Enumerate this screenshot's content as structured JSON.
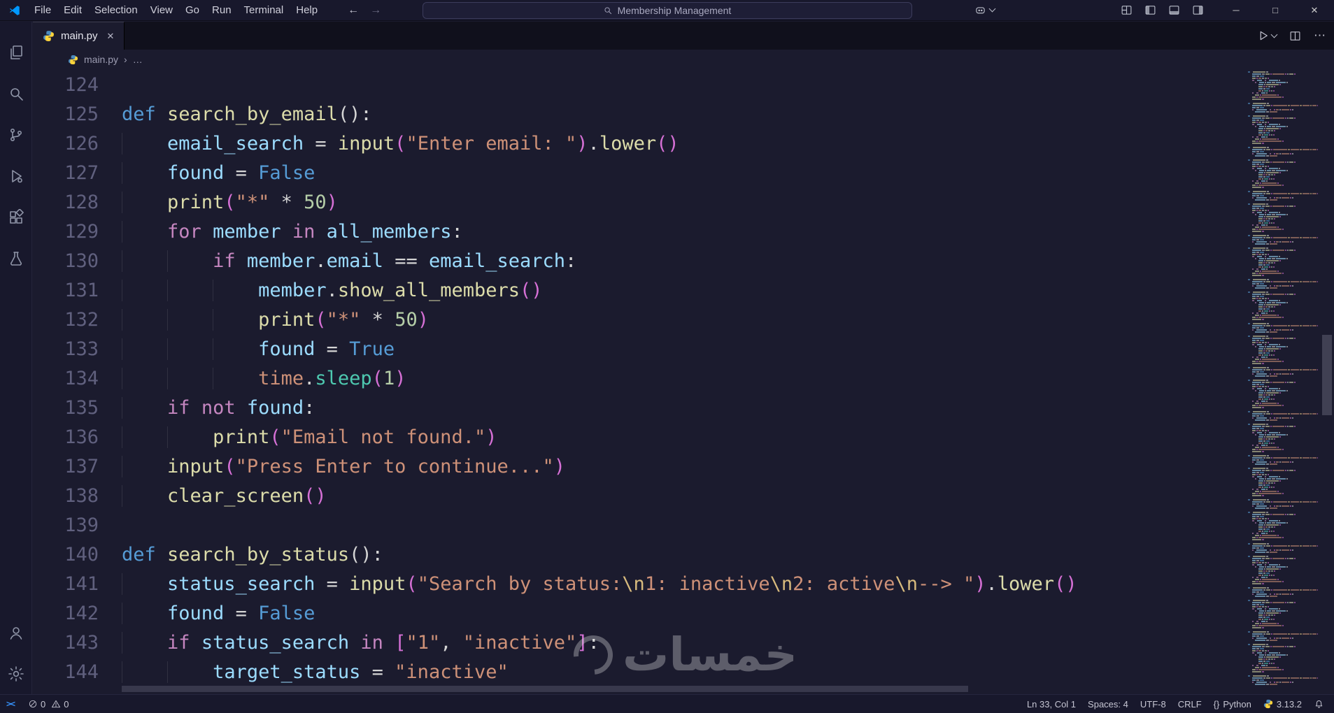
{
  "window": {
    "menus": [
      "File",
      "Edit",
      "Selection",
      "View",
      "Go",
      "Run",
      "Terminal",
      "Help"
    ],
    "search_text": "Membership Management",
    "back_glyph": "←",
    "forward_glyph": "→",
    "controls": {
      "minimize": "─",
      "maximize": "□",
      "close": "✕"
    }
  },
  "tabs": {
    "active": {
      "label": "main.py",
      "close_glyph": "✕"
    },
    "more_actions": "⋯"
  },
  "breadcrumb": {
    "file": "main.py",
    "separator": "›",
    "more": "…"
  },
  "editor": {
    "lines": [
      {
        "num": "124",
        "tokens": []
      },
      {
        "num": "125",
        "tokens": [
          {
            "t": "def",
            "c": "kw"
          },
          {
            "t": " ",
            "c": "pl"
          },
          {
            "t": "search_by_email",
            "c": "fn"
          },
          {
            "t": "():",
            "c": "pl"
          }
        ]
      },
      {
        "num": "126",
        "tokens": [
          {
            "t": "    ",
            "c": "pl"
          },
          {
            "t": "email_search",
            "c": "var"
          },
          {
            "t": " = ",
            "c": "pl"
          },
          {
            "t": "input",
            "c": "fn"
          },
          {
            "t": "(",
            "c": "br"
          },
          {
            "t": "\"Enter email: \"",
            "c": "str"
          },
          {
            "t": ")",
            "c": "br"
          },
          {
            "t": ".",
            "c": "pl"
          },
          {
            "t": "lower",
            "c": "fn"
          },
          {
            "t": "()",
            "c": "br"
          }
        ]
      },
      {
        "num": "127",
        "tokens": [
          {
            "t": "    ",
            "c": "pl"
          },
          {
            "t": "found",
            "c": "var"
          },
          {
            "t": " = ",
            "c": "pl"
          },
          {
            "t": "False",
            "c": "kw"
          }
        ]
      },
      {
        "num": "128",
        "tokens": [
          {
            "t": "    ",
            "c": "pl"
          },
          {
            "t": "print",
            "c": "fn"
          },
          {
            "t": "(",
            "c": "br"
          },
          {
            "t": "\"*\"",
            "c": "str"
          },
          {
            "t": " * ",
            "c": "pl"
          },
          {
            "t": "50",
            "c": "num"
          },
          {
            "t": ")",
            "c": "br"
          }
        ]
      },
      {
        "num": "129",
        "tokens": [
          {
            "t": "    ",
            "c": "pl"
          },
          {
            "t": "for",
            "c": "ctrl"
          },
          {
            "t": " ",
            "c": "pl"
          },
          {
            "t": "member",
            "c": "var"
          },
          {
            "t": " ",
            "c": "pl"
          },
          {
            "t": "in",
            "c": "ctrl"
          },
          {
            "t": " ",
            "c": "pl"
          },
          {
            "t": "all_members",
            "c": "var"
          },
          {
            "t": ":",
            "c": "pl"
          }
        ]
      },
      {
        "num": "130",
        "tokens": [
          {
            "t": "        ",
            "c": "pl"
          },
          {
            "t": "if",
            "c": "ctrl"
          },
          {
            "t": " ",
            "c": "pl"
          },
          {
            "t": "member",
            "c": "var"
          },
          {
            "t": ".",
            "c": "pl"
          },
          {
            "t": "email",
            "c": "var"
          },
          {
            "t": " == ",
            "c": "pl"
          },
          {
            "t": "email_search",
            "c": "var"
          },
          {
            "t": ":",
            "c": "pl"
          }
        ]
      },
      {
        "num": "131",
        "tokens": [
          {
            "t": "            ",
            "c": "pl"
          },
          {
            "t": "member",
            "c": "var"
          },
          {
            "t": ".",
            "c": "pl"
          },
          {
            "t": "show_all_members",
            "c": "fn"
          },
          {
            "t": "()",
            "c": "br"
          }
        ]
      },
      {
        "num": "132",
        "tokens": [
          {
            "t": "            ",
            "c": "pl"
          },
          {
            "t": "print",
            "c": "fn"
          },
          {
            "t": "(",
            "c": "br"
          },
          {
            "t": "\"*\"",
            "c": "str"
          },
          {
            "t": " * ",
            "c": "pl"
          },
          {
            "t": "50",
            "c": "num"
          },
          {
            "t": ")",
            "c": "br"
          }
        ]
      },
      {
        "num": "133",
        "tokens": [
          {
            "t": "            ",
            "c": "pl"
          },
          {
            "t": "found",
            "c": "var"
          },
          {
            "t": " = ",
            "c": "pl"
          },
          {
            "t": "True",
            "c": "kw"
          }
        ]
      },
      {
        "num": "134",
        "tokens": [
          {
            "t": "            ",
            "c": "pl"
          },
          {
            "t": "time",
            "c": "mod"
          },
          {
            "t": ".",
            "c": "pl"
          },
          {
            "t": "sleep",
            "c": "meth"
          },
          {
            "t": "(",
            "c": "br"
          },
          {
            "t": "1",
            "c": "num"
          },
          {
            "t": ")",
            "c": "br"
          }
        ]
      },
      {
        "num": "135",
        "tokens": [
          {
            "t": "    ",
            "c": "pl"
          },
          {
            "t": "if",
            "c": "ctrl"
          },
          {
            "t": " ",
            "c": "pl"
          },
          {
            "t": "not",
            "c": "ctrl"
          },
          {
            "t": " ",
            "c": "pl"
          },
          {
            "t": "found",
            "c": "var"
          },
          {
            "t": ":",
            "c": "pl"
          }
        ]
      },
      {
        "num": "136",
        "tokens": [
          {
            "t": "        ",
            "c": "pl"
          },
          {
            "t": "print",
            "c": "fn"
          },
          {
            "t": "(",
            "c": "br"
          },
          {
            "t": "\"Email not found.\"",
            "c": "str"
          },
          {
            "t": ")",
            "c": "br"
          }
        ]
      },
      {
        "num": "137",
        "tokens": [
          {
            "t": "    ",
            "c": "pl"
          },
          {
            "t": "input",
            "c": "fn"
          },
          {
            "t": "(",
            "c": "br"
          },
          {
            "t": "\"Press Enter to continue...\"",
            "c": "str"
          },
          {
            "t": ")",
            "c": "br"
          }
        ]
      },
      {
        "num": "138",
        "tokens": [
          {
            "t": "    ",
            "c": "pl"
          },
          {
            "t": "clear_screen",
            "c": "fn"
          },
          {
            "t": "()",
            "c": "br"
          }
        ]
      },
      {
        "num": "139",
        "tokens": []
      },
      {
        "num": "140",
        "tokens": [
          {
            "t": "def",
            "c": "kw"
          },
          {
            "t": " ",
            "c": "pl"
          },
          {
            "t": "search_by_status",
            "c": "fn"
          },
          {
            "t": "():",
            "c": "pl"
          }
        ]
      },
      {
        "num": "141",
        "tokens": [
          {
            "t": "    ",
            "c": "pl"
          },
          {
            "t": "status_search",
            "c": "var"
          },
          {
            "t": " = ",
            "c": "pl"
          },
          {
            "t": "input",
            "c": "fn"
          },
          {
            "t": "(",
            "c": "br"
          },
          {
            "t": "\"Search by status:",
            "c": "str"
          },
          {
            "t": "\\n",
            "c": "esc"
          },
          {
            "t": "1: inactive",
            "c": "str"
          },
          {
            "t": "\\n",
            "c": "esc"
          },
          {
            "t": "2: active",
            "c": "str"
          },
          {
            "t": "\\n",
            "c": "esc"
          },
          {
            "t": "--> \"",
            "c": "str"
          },
          {
            "t": ")",
            "c": "br"
          },
          {
            "t": ".",
            "c": "pl"
          },
          {
            "t": "lower",
            "c": "fn"
          },
          {
            "t": "()",
            "c": "br"
          }
        ]
      },
      {
        "num": "142",
        "tokens": [
          {
            "t": "    ",
            "c": "pl"
          },
          {
            "t": "found",
            "c": "var"
          },
          {
            "t": " = ",
            "c": "pl"
          },
          {
            "t": "False",
            "c": "kw"
          }
        ]
      },
      {
        "num": "143",
        "tokens": [
          {
            "t": "    ",
            "c": "pl"
          },
          {
            "t": "if",
            "c": "ctrl"
          },
          {
            "t": " ",
            "c": "pl"
          },
          {
            "t": "status_search",
            "c": "var"
          },
          {
            "t": " ",
            "c": "pl"
          },
          {
            "t": "in",
            "c": "ctrl"
          },
          {
            "t": " ",
            "c": "pl"
          },
          {
            "t": "[",
            "c": "br"
          },
          {
            "t": "\"1\"",
            "c": "str"
          },
          {
            "t": ", ",
            "c": "pl"
          },
          {
            "t": "\"inactive\"",
            "c": "str"
          },
          {
            "t": "]",
            "c": "br"
          },
          {
            "t": ":",
            "c": "pl"
          }
        ]
      },
      {
        "num": "144",
        "tokens": [
          {
            "t": "        ",
            "c": "pl"
          },
          {
            "t": "target_status",
            "c": "var"
          },
          {
            "t": " = ",
            "c": "pl"
          },
          {
            "t": "\"inactive\"",
            "c": "str"
          }
        ]
      }
    ]
  },
  "status_bar": {
    "remote": "><",
    "errors": "0",
    "warnings": "0",
    "cursor": "Ln 33, Col 1",
    "indentation": "Spaces: 4",
    "encoding": "UTF-8",
    "eol": "CRLF",
    "language_brackets": "{}",
    "language": "Python",
    "interpreter_version": "3.13.2"
  },
  "watermark": {
    "text": "خمسات"
  },
  "colors": {
    "syntax": {
      "kw": "#569cd6",
      "ctrl": "#c586c0",
      "fn": "#dcdcaa",
      "var": "#9cdcfe",
      "str": "#ce9178",
      "num": "#b5cea8",
      "pl": "#d4d4d4",
      "br": "#d670d6",
      "esc": "#d7ba7d",
      "mod": "#ce9178",
      "meth": "#4ec9b0"
    },
    "ui": {
      "accent_blue": "#0098ff",
      "remote_blue": "#3794ff",
      "python_blue": "#4b8bbe",
      "python_yellow": "#ffd43b"
    }
  }
}
